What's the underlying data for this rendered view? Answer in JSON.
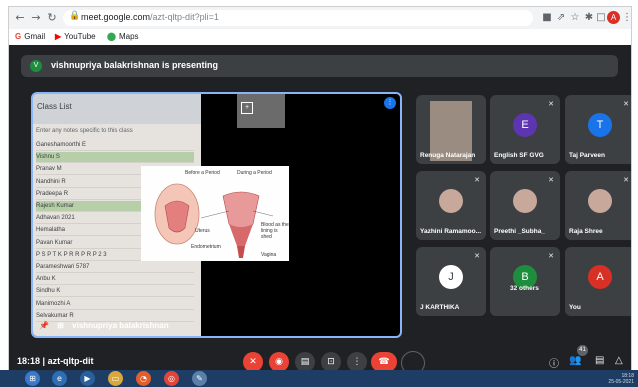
{
  "browser": {
    "url_host": "meet.google.com",
    "url_path": "/azt-qltp-dit?pli=1",
    "bookmarks": [
      {
        "label": "Gmail",
        "icon": "gmail-icon"
      },
      {
        "label": "YouTube",
        "icon": "youtube-icon"
      },
      {
        "label": "Maps",
        "icon": "maps-icon"
      }
    ],
    "profile_initial": "A"
  },
  "meet": {
    "presenter_initial": "V",
    "presenting_text": "vishnupriya balakrishnan is presenting",
    "stage_name": "vishnupriya balakrishnan",
    "sheet": {
      "header": "Class List",
      "note": "Enter any notes specific to this class",
      "rows": [
        "Ganeshamoorthi E",
        "Vishnu S",
        "Pranav M",
        "Nandhini R",
        "Pradeepa R",
        "Rajesh Kumar",
        "Adhavan 2021",
        "Hemalatha",
        "Pavan Kumar",
        "P S P T K P R R P R P 2 3",
        "Parameshwari 5787",
        "Anbu K",
        "Sindhu K",
        "Manimozhi A",
        "Selvakumar R"
      ]
    },
    "diagram": {
      "caption_left": "Before a Period",
      "caption_right": "During a Period",
      "label_1": "Uterus",
      "label_2": "Endometrium",
      "label_3": "Vagina",
      "label_4": "Blood as the lining is shed"
    },
    "participants": [
      {
        "name": "Renuga Natarajan",
        "kind": "camera"
      },
      {
        "name": "English SF GVG",
        "initial": "E",
        "color": "#5e35b1"
      },
      {
        "name": "Taj Parveen",
        "initial": "T",
        "color": "#1a73e8"
      },
      {
        "name": "Yazhini Ramamoo...",
        "kind": "photo"
      },
      {
        "name": "Preethi _Subha_",
        "kind": "photo"
      },
      {
        "name": "Raja Shree",
        "kind": "photo"
      },
      {
        "name": "J KARTHIKA",
        "initial": "J",
        "color": "#ffffff"
      },
      {
        "name": "32 others",
        "initial": "B",
        "color": "#1e8e3e"
      },
      {
        "name": "You",
        "initial": "A",
        "color": "#d93025"
      }
    ],
    "meeting_time": "18:18",
    "meeting_code": "azt-qltp-dit",
    "people_count": "41"
  },
  "taskbar": {
    "clock_time": "18:18",
    "clock_date": "25-05-2021"
  },
  "colors": {
    "meet_bg": "#202124",
    "tile_bg": "#3c4043",
    "accent_blue": "#8ab4f8",
    "end_call_red": "#ea4335",
    "taskbar_blue": "#1e3d64"
  }
}
